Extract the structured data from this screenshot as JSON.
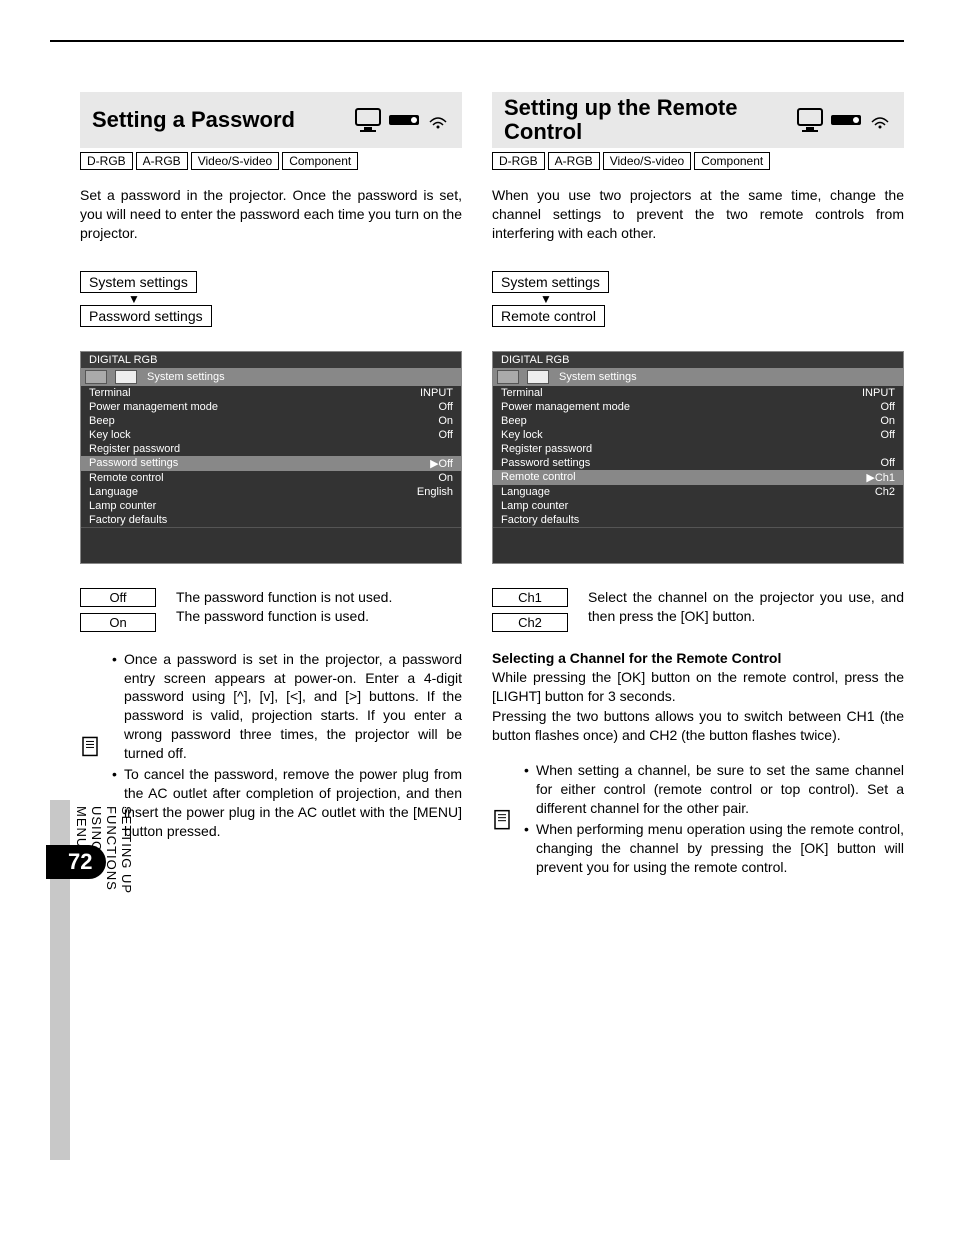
{
  "page_number": "72",
  "side_label": "SETTING UP FUNCTIONS USING MENUS",
  "badges": [
    "D-RGB",
    "A-RGB",
    "Video/S-video",
    "Component"
  ],
  "left": {
    "title": "Setting a Password",
    "intro": "Set a password in the projector. Once the password is set, you will need to enter the password each time you turn on the projector.",
    "nav_from": "System settings",
    "nav_to": "Password settings",
    "menu": {
      "title": "DIGITAL RGB",
      "tab_label": "System settings",
      "rows": [
        {
          "label": "Terminal",
          "value": "INPUT",
          "hl": false
        },
        {
          "label": "Power management mode",
          "value": "Off",
          "hl": false
        },
        {
          "label": "Beep",
          "value": "On",
          "hl": false
        },
        {
          "label": "Key lock",
          "value": "Off",
          "hl": false
        },
        {
          "label": "Register password",
          "value": "",
          "hl": false
        },
        {
          "label": "Password settings",
          "value": "▶Off",
          "hl": true
        },
        {
          "label": "Remote control",
          "value": "On",
          "hl": false
        },
        {
          "label": "Language",
          "value": "English",
          "hl": false
        },
        {
          "label": "Lamp counter",
          "value": "",
          "hl": false
        },
        {
          "label": "Factory defaults",
          "value": "",
          "hl": false
        }
      ]
    },
    "options": [
      {
        "label": "Off",
        "desc": "The password function is not used."
      },
      {
        "label": "On",
        "desc": "The password function is used."
      }
    ],
    "notes": [
      "Once a password is set in the projector, a password entry screen appears at power-on.  Enter a 4-digit password using [^], [v], [<], and [>] buttons. If the password is valid, projection starts. If you enter a wrong password three times, the projector will be turned off.",
      "To cancel the password, remove the power plug from the AC outlet after completion of projection, and then insert the power plug in the AC outlet with the [MENU] button pressed."
    ]
  },
  "right": {
    "title": "Setting up the Remote Control",
    "intro": "When you use two projectors at the same time, change the channel settings to prevent the two remote controls from interfering with each other.",
    "nav_from": "System settings",
    "nav_to": "Remote control",
    "menu": {
      "title": "DIGITAL RGB",
      "tab_label": "System settings",
      "rows": [
        {
          "label": "Terminal",
          "value": "INPUT",
          "hl": false
        },
        {
          "label": "Power management mode",
          "value": "Off",
          "hl": false
        },
        {
          "label": "Beep",
          "value": "On",
          "hl": false
        },
        {
          "label": "Key lock",
          "value": "Off",
          "hl": false
        },
        {
          "label": "Register password",
          "value": "",
          "hl": false
        },
        {
          "label": "Password settings",
          "value": "Off",
          "hl": false
        },
        {
          "label": "Remote control",
          "value": "▶Ch1",
          "hl": true
        },
        {
          "label": "Language",
          "value": "Ch2",
          "hl": false
        },
        {
          "label": "Lamp counter",
          "value": "",
          "hl": false
        },
        {
          "label": "Factory defaults",
          "value": "",
          "hl": false
        }
      ]
    },
    "options": [
      {
        "label": "Ch1"
      },
      {
        "label": "Ch2"
      }
    ],
    "option_desc": "Select the channel on the projector you use, and then press the [OK] button.",
    "subhead": "Selecting a Channel for the Remote Control",
    "sub_para1": "While pressing the [OK] button on the remote control, press the [LIGHT] button for 3 seconds.",
    "sub_para2": "Pressing the two buttons allows you to switch between CH1 (the button flashes once) and CH2 (the button flashes twice).",
    "notes": [
      "When setting a channel, be sure to set the same channel for either control (remote control or top control). Set a different channel for the other pair.",
      "When performing menu operation using the remote control, changing the channel by pressing the [OK] button will prevent you for using the remote control."
    ]
  }
}
